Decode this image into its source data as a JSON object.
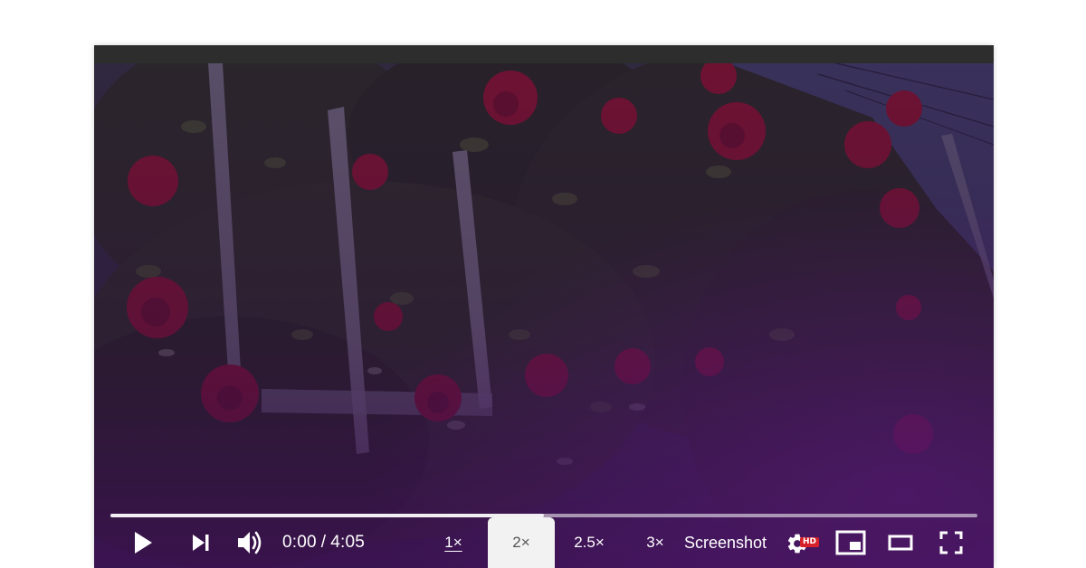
{
  "player": {
    "time": {
      "current": "0:00",
      "separator": "/",
      "duration": "4:05"
    },
    "progress_fraction": 0.5,
    "speeds": [
      {
        "label": "1×",
        "state": "underlined"
      },
      {
        "label": "2×",
        "state": "selected"
      },
      {
        "label": "2.5×",
        "state": "normal"
      },
      {
        "label": "3×",
        "state": "normal"
      }
    ],
    "screenshot_label": "Screenshot",
    "settings_badge": "HD",
    "icons": {
      "play": "play-icon",
      "next": "skip-next-icon",
      "volume": "volume-icon",
      "settings": "gear-icon",
      "miniplayer": "miniplayer-icon",
      "theater": "theater-mode-icon",
      "fullscreen": "fullscreen-icon"
    },
    "colors": {
      "overlay": "#3a1448",
      "badge": "#d6202a",
      "selected_speed_bg": "#f2f2f2"
    }
  }
}
